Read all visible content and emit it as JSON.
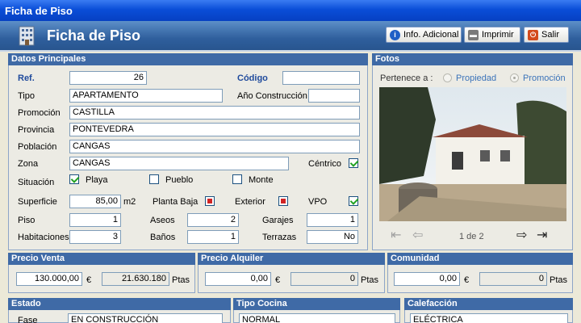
{
  "window": {
    "title": "Ficha de Piso"
  },
  "header": {
    "title": "Ficha de Piso",
    "buttons": {
      "info": "Info. Adicional",
      "print": "Imprimir",
      "exit": "Salir"
    }
  },
  "principales": {
    "heading": "Datos Principales",
    "ref": {
      "label": "Ref.",
      "value": "26"
    },
    "codigo": {
      "label": "Código",
      "value": ""
    },
    "tipo": {
      "label": "Tipo",
      "value": "APARTAMENTO"
    },
    "anio": {
      "label": "Año Construcción",
      "value": ""
    },
    "promocion": {
      "label": "Promoción",
      "value": "CASTILLA"
    },
    "provincia": {
      "label": "Provincia",
      "value": "PONTEVEDRA"
    },
    "poblacion": {
      "label": "Población",
      "value": "CANGAS"
    },
    "zona": {
      "label": "Zona",
      "value": "CANGAS"
    },
    "centrico": {
      "label": "Céntrico",
      "checked": true
    },
    "situacion": {
      "label": "Situación",
      "playa": "Playa",
      "pueblo": "Pueblo",
      "monte": "Monte",
      "playa_checked": true
    },
    "superficie": {
      "label": "Superficie",
      "value": "85,00",
      "unit": "m2"
    },
    "planta_baja": {
      "label": "Planta Baja"
    },
    "exterior": {
      "label": "Exterior"
    },
    "vpo": {
      "label": "VPO",
      "checked": true
    },
    "piso": {
      "label": "Piso",
      "value": "1"
    },
    "aseos": {
      "label": "Aseos",
      "value": "2"
    },
    "garajes": {
      "label": "Garajes",
      "value": "1"
    },
    "habitaciones": {
      "label": "Habitaciones",
      "value": "3"
    },
    "banos": {
      "label": "Baños",
      "value": "1"
    },
    "terrazas": {
      "label": "Terrazas",
      "value": "No"
    }
  },
  "fotos": {
    "heading": "Fotos",
    "pertenece": "Pertenece a :",
    "propiedad": "Propiedad",
    "promocion": "Promoción",
    "counter": "1 de 2"
  },
  "precio_venta": {
    "heading": "Precio Venta",
    "euros": "130.000,00",
    "currency": "€",
    "ptas": "21.630.180",
    "ptas_label": "Ptas"
  },
  "precio_alquiler": {
    "heading": "Precio Alquiler",
    "euros": "0,00",
    "currency": "€",
    "ptas": "0",
    "ptas_label": "Ptas"
  },
  "comunidad": {
    "heading": "Comunidad",
    "euros": "0,00",
    "currency": "€",
    "ptas": "0",
    "ptas_label": "Ptas"
  },
  "estado": {
    "heading": "Estado",
    "fase_label": "Fase",
    "fase_value": "EN CONSTRUCCIÓN"
  },
  "tipo_cocina": {
    "heading": "Tipo Cocina",
    "value": "NORMAL"
  },
  "calefaccion": {
    "heading": "Calefacción",
    "value": "ELÉCTRICA"
  }
}
